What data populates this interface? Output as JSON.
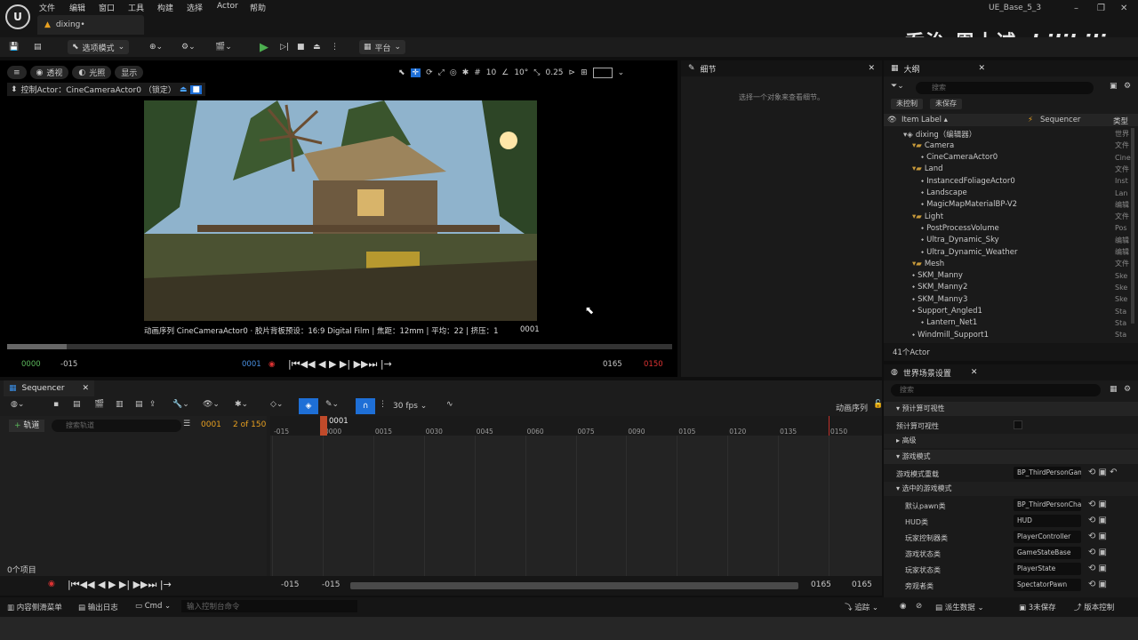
{
  "app": {
    "menus": [
      "文件",
      "编辑",
      "窗口",
      "工具",
      "构建",
      "选择",
      "Actor",
      "帮助"
    ],
    "doc_tab": "dixing•",
    "project": "UE_Base_5_3",
    "watermark": "乔治-周士诚",
    "watermark_logo": "bilibili"
  },
  "toolbar": {
    "mode": "选项模式",
    "platform": "平台"
  },
  "viewport": {
    "perspective": "透视",
    "lit": "光照",
    "show": "显示",
    "pilot": "控制Actor：CineCameraActor0 （锁定）",
    "grid_size": "10",
    "rotation_snap": "10°",
    "scale_snap": "0.25",
    "camera_meta": "动画序列 CineCameraActor0 · 胶片背板预设：16:9 Digital Film | 焦距：12mm | 平均：22 | 挤压：1",
    "camera_frame": "0001",
    "playback_progress": 0.09,
    "tc_start": "0000",
    "tc_pre": "-015",
    "tc_current": "0001",
    "tc_end": "0165",
    "tc_end_red": "0150"
  },
  "details": {
    "title": "细节",
    "empty": "选择一个对象来查看细节。"
  },
  "outliner": {
    "title": "大纲",
    "search_placeholder": "搜索",
    "unsaved_chip": "未控制",
    "unsaved_chip2": "未保存",
    "col_label": "Item Label ▴",
    "col_seq": "Sequencer",
    "col_type": "类型",
    "rows": [
      {
        "label": "dixing（编辑器）",
        "type": "世界",
        "kind": "world",
        "indent": 0
      },
      {
        "label": "Camera",
        "type": "文件",
        "kind": "folder",
        "indent": 1
      },
      {
        "label": "CineCameraActor0",
        "type": "Cine",
        "kind": "actor",
        "indent": 2
      },
      {
        "label": "Land",
        "type": "文件",
        "kind": "folder",
        "indent": 1
      },
      {
        "label": "InstancedFoliageActor0",
        "type": "Inst",
        "kind": "actor",
        "indent": 2
      },
      {
        "label": "Landscape",
        "type": "Lan",
        "kind": "actor",
        "indent": 2
      },
      {
        "label": "MagicMapMaterialBP-V2",
        "type": "编辑",
        "kind": "actor",
        "indent": 2
      },
      {
        "label": "Light",
        "type": "文件",
        "kind": "folder",
        "indent": 1
      },
      {
        "label": "PostProcessVolume",
        "type": "Pos",
        "kind": "actor",
        "indent": 2
      },
      {
        "label": "Ultra_Dynamic_Sky",
        "type": "编辑",
        "kind": "actor",
        "indent": 2
      },
      {
        "label": "Ultra_Dynamic_Weather",
        "type": "编辑",
        "kind": "actor",
        "indent": 2
      },
      {
        "label": "Mesh",
        "type": "文件",
        "kind": "folder",
        "indent": 1
      },
      {
        "label": "SKM_Manny",
        "type": "Ske",
        "kind": "actor",
        "indent": 1
      },
      {
        "label": "SKM_Manny2",
        "type": "Ske",
        "kind": "actor",
        "indent": 1
      },
      {
        "label": "SKM_Manny3",
        "type": "Ske",
        "kind": "actor",
        "indent": 1
      },
      {
        "label": "Support_Angled1",
        "type": "Sta",
        "kind": "actor",
        "indent": 1
      },
      {
        "label": "Lantern_Net1",
        "type": "Sta",
        "kind": "actor",
        "indent": 2
      },
      {
        "label": "Windmill_Support1",
        "type": "Sta",
        "kind": "actor",
        "indent": 1
      }
    ],
    "count": "41个Actor"
  },
  "world_settings": {
    "title": "世界场景设置",
    "search_placeholder": "搜索",
    "sections": {
      "precomputed": "预计算可视性",
      "precomputed_prop": "预计算可视性",
      "advanced": "高级",
      "game_mode": "游戏模式",
      "selected": "选中的游戏模式"
    },
    "props": [
      {
        "label": "游戏模式重载",
        "value": "BP_ThirdPersonGameMode"
      },
      {
        "label": "默认pawn类",
        "value": "BP_ThirdPersonCharacter"
      },
      {
        "label": "HUD类",
        "value": "HUD"
      },
      {
        "label": "玩家控制器类",
        "value": "PlayerController"
      },
      {
        "label": "游戏状态类",
        "value": "GameStateBase"
      },
      {
        "label": "玩家状态类",
        "value": "PlayerState"
      },
      {
        "label": "旁观者类",
        "value": "SpectatorPawn"
      }
    ]
  },
  "sequencer": {
    "tab": "Sequencer",
    "fps": "30 fps",
    "sequence_name": "动画序列",
    "track_button": "轨道",
    "search_placeholder": "搜索轨道",
    "frame": "0001",
    "frame_of": "2 of 150",
    "current_marker": "0001",
    "ticks": [
      "-015",
      "0000",
      "0015",
      "0030",
      "0045",
      "0060",
      "0075",
      "0090",
      "0105",
      "0120",
      "0135",
      "0150"
    ],
    "items": "0个项目",
    "foot_left1": "-015",
    "foot_left2": "-015",
    "foot_right1": "0165",
    "foot_right2": "0165"
  },
  "statusbar": {
    "content_drawer": "内容侧滑菜单",
    "output_log": "输出日志",
    "cmd": "Cmd",
    "cmd_placeholder": "输入控制台命令",
    "trace": "追踪",
    "derived": "派生数据",
    "unsaved": "3未保存",
    "source_control": "版本控制"
  }
}
